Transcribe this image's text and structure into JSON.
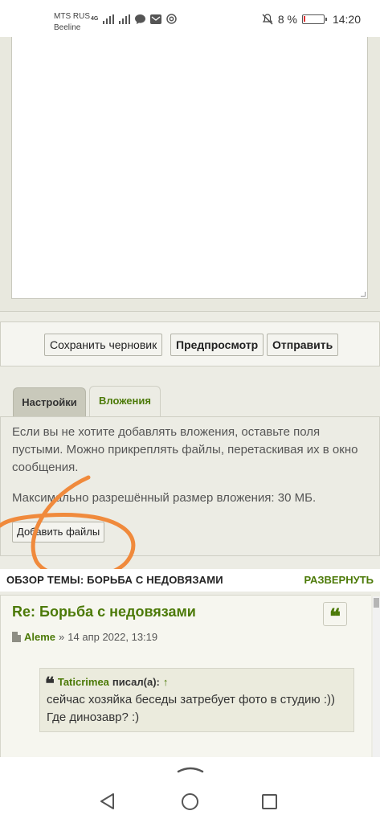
{
  "status_bar": {
    "carrier1": "MTS RUS",
    "carrier2": "Beeline",
    "network": "4G",
    "battery_percent": "8 %",
    "battery_level": 0.08,
    "time": "14:20",
    "icons": [
      "signal-icon",
      "signal-icon",
      "chat-icon",
      "mail-icon",
      "at-icon",
      "mute-icon",
      "battery-icon"
    ]
  },
  "editor_buttons": {
    "save_draft": "Сохранить черновик",
    "preview": "Предпросмотр",
    "submit": "Отправить"
  },
  "tabs": {
    "settings": "Настройки",
    "attachments": "Вложения"
  },
  "attachments": {
    "hint": "Если вы не хотите добавлять вложения, оставьте поля пустыми. Можно прикреплять файлы, перетаскивая их в окно сообщения.",
    "max_size": "Максимально разрешённый размер вложения: 30 МБ.",
    "add_files": "Добавить файлы"
  },
  "annotation": {
    "color": "#f08a3c"
  },
  "topic_review": {
    "title": "ОБЗОР ТЕМЫ: БОРЬБА С НЕДОВЯЗАМИ",
    "expand": "РАЗВЕРНУТЬ"
  },
  "post": {
    "title": "Re: Борьба с недовязами",
    "author": "Aleme",
    "separator": "»",
    "date": "14 апр 2022, 13:19",
    "quote_button": "❝",
    "quote": {
      "mark": "❝",
      "user": "Taticrimea",
      "wrote": "писал(а):",
      "arrow": "↑",
      "text": "сейчас хозяйка беседы затребует фото в студию :)) Где динозавр? :)"
    }
  },
  "colors": {
    "accent_green": "#4c7a08",
    "panel_bg": "#ecece4",
    "battery_low": "#e03030"
  }
}
